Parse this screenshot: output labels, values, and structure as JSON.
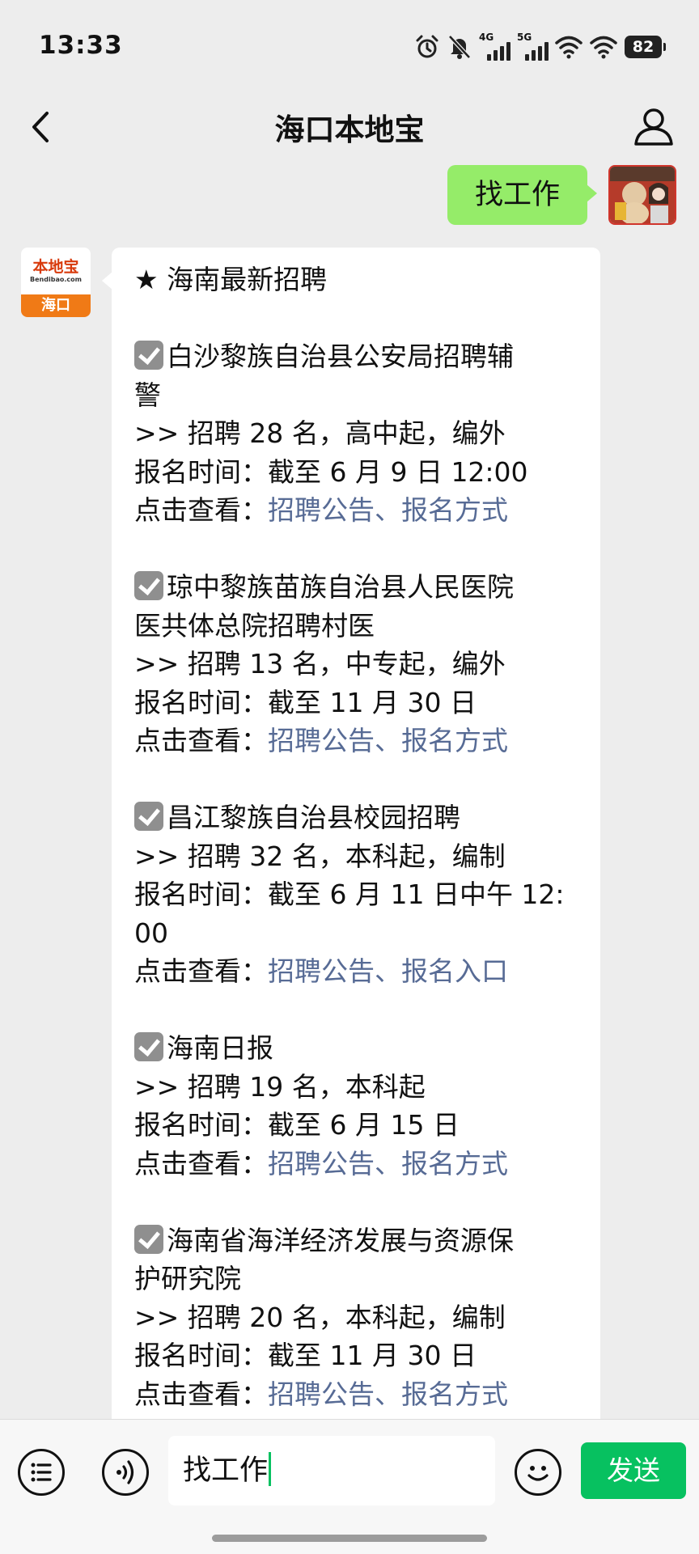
{
  "status_bar": {
    "time": "13:33",
    "network_1": "4G",
    "network_2": "5G",
    "battery": "82"
  },
  "header": {
    "title": "海口本地宝"
  },
  "chat": {
    "outgoing_message": "找工作",
    "bot_avatar": {
      "brand": "本地宝",
      "sub": "Bendibao.com",
      "city": "海口"
    },
    "incoming": {
      "heading": "★ 海南最新招聘",
      "jobs": [
        {
          "title_lines": [
            "白沙黎族自治县公安局招聘辅",
            "警"
          ],
          "detail": ">> 招聘 28 名，高中起，编外",
          "deadline_lines": [
            "报名时间：截至 6 月 9 日 12:00"
          ],
          "view_label": "点击查看：",
          "view_link": "招聘公告、报名方式"
        },
        {
          "title_lines": [
            "琼中黎族苗族自治县人民医院",
            "医共体总院招聘村医"
          ],
          "detail": ">> 招聘 13 名，中专起，编外",
          "deadline_lines": [
            "报名时间：截至 11 月 30 日"
          ],
          "view_label": "点击查看：",
          "view_link": "招聘公告、报名方式"
        },
        {
          "title_lines": [
            "昌江黎族自治县校园招聘"
          ],
          "detail": ">> 招聘 32 名，本科起，编制",
          "deadline_lines": [
            "报名时间：截至 6 月 11 日中午 12:",
            "00"
          ],
          "view_label": "点击查看：",
          "view_link": "招聘公告、报名入口"
        },
        {
          "title_lines": [
            "海南日报"
          ],
          "detail": ">> 招聘 19 名，本科起",
          "deadline_lines": [
            "报名时间：截至 6 月 15 日"
          ],
          "view_label": "点击查看：",
          "view_link": "招聘公告、报名方式"
        },
        {
          "title_lines": [
            "海南省海洋经济发展与资源保",
            "护研究院"
          ],
          "detail": ">> 招聘 20 名，本科起，编制",
          "deadline_lines": [
            "报名时间：截至 11 月 30 日"
          ],
          "view_label": "点击查看：",
          "view_link": "招聘公告、报名方式"
        }
      ]
    }
  },
  "input_bar": {
    "input_value": "找工作",
    "send_label": "发送"
  },
  "colors": {
    "bubble_out": "#95ec69",
    "link": "#576b95",
    "send": "#07c160"
  }
}
